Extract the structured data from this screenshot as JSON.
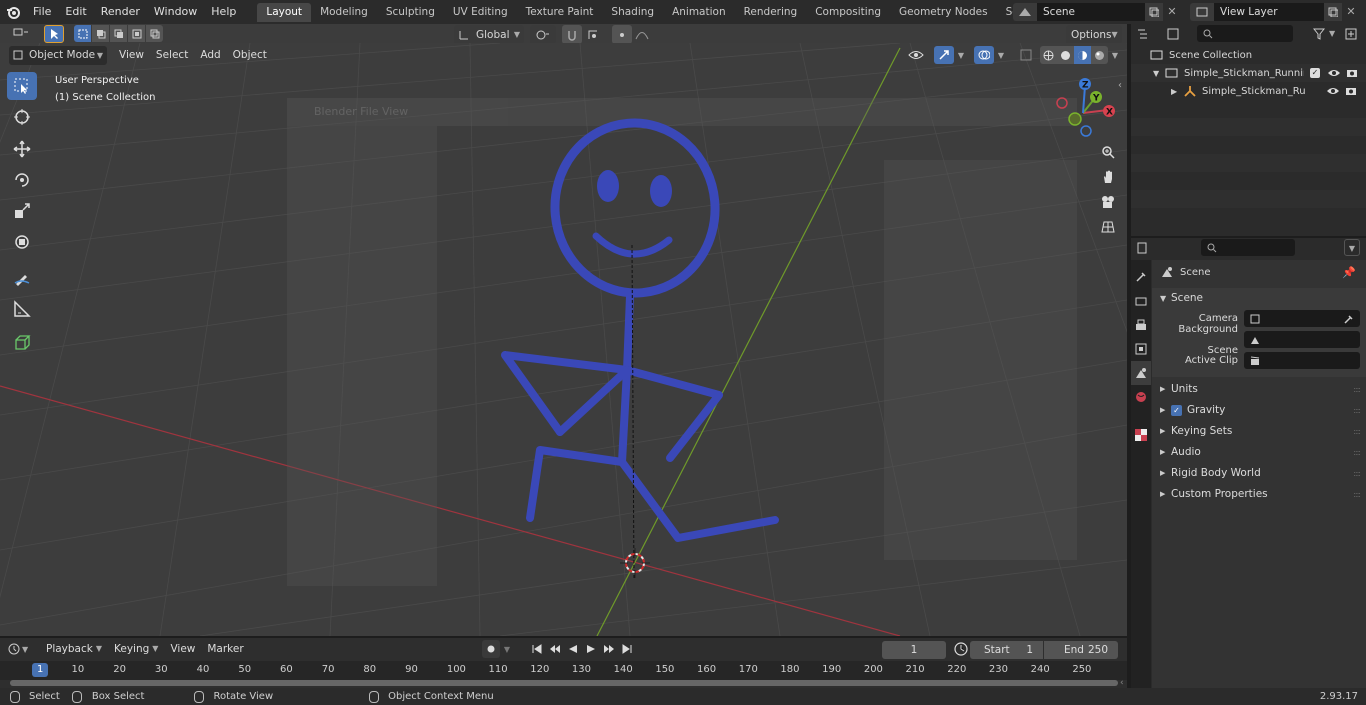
{
  "topbar": {
    "menus": [
      "File",
      "Edit",
      "Render",
      "Window",
      "Help"
    ],
    "workspaces": [
      "Layout",
      "Modeling",
      "Sculpting",
      "UV Editing",
      "Texture Paint",
      "Shading",
      "Animation",
      "Rendering",
      "Compositing",
      "Geometry Nodes",
      "Scripting"
    ],
    "active_workspace": "Layout",
    "scene_name": "Scene",
    "view_layer": "View Layer"
  },
  "viewport_header": {
    "mode": "Object Mode",
    "menus": [
      "View",
      "Select",
      "Add",
      "Object"
    ],
    "orientation": "Global",
    "options_label": "Options"
  },
  "viewport": {
    "perspective": "User Perspective",
    "collection": "(1) Scene Collection",
    "gizmo": {
      "x": "X",
      "y": "Y",
      "z": "Z"
    },
    "overlay_title": "Blender File View"
  },
  "outliner": {
    "root": "Scene Collection",
    "items": [
      "Simple_Stickman_Running_Pc",
      "Simple_Stickman_Runnir"
    ]
  },
  "properties": {
    "context": "Scene",
    "panel": "Scene",
    "fields": [
      {
        "label": "Camera"
      },
      {
        "label": "Background Scene"
      },
      {
        "label": "Active Clip"
      }
    ],
    "subpanels": [
      "Units",
      "Gravity",
      "Keying Sets",
      "Audio",
      "Rigid Body World",
      "Custom Properties"
    ],
    "gravity_checked": true
  },
  "timeline": {
    "menus": [
      "Playback",
      "Keying",
      "View",
      "Marker"
    ],
    "current_frame": "1",
    "start_label": "Start",
    "start": "1",
    "end_label": "End",
    "end": "250",
    "ruler": [
      "1",
      "10",
      "20",
      "30",
      "40",
      "50",
      "60",
      "70",
      "80",
      "90",
      "100",
      "110",
      "120",
      "130",
      "140",
      "150",
      "160",
      "170",
      "180",
      "190",
      "200",
      "210",
      "220",
      "230",
      "240",
      "250"
    ]
  },
  "statusbar": {
    "select": "Select",
    "box_select": "Box Select",
    "rotate_view": "Rotate View",
    "context_menu": "Object Context Menu",
    "version": "2.93.17"
  },
  "colors": {
    "accent": "#4772b3",
    "stickman": "#3a48b8",
    "x_axis": "#b0343f",
    "y_axis": "#7aa12c"
  }
}
